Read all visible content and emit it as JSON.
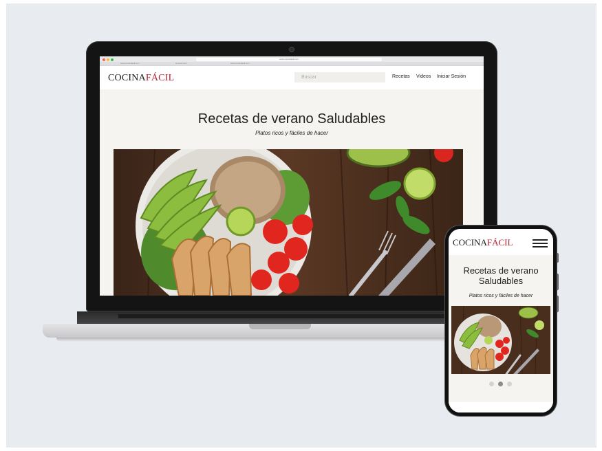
{
  "browser": {
    "url": "www.cocinafacil.com",
    "tabs": [
      "www.cocinafacil.com",
      "Cocina Fácil",
      "www.cocinafacil.com"
    ]
  },
  "site": {
    "logo_main": "COCINA",
    "logo_accent": "FÁCIL",
    "accent_color": "#b01e2f",
    "search_placeholder": "Buscar",
    "nav": {
      "recipes": "Recetas",
      "videos": "Videos",
      "login": "Iniciar Sesión"
    },
    "hero": {
      "title": "Recetas de verano Saludables",
      "subtitle": "Platos ricos y fáciles de hacer",
      "image_alt": "salad-bowl-photo"
    }
  },
  "mobile": {
    "logo_main": "COCINA",
    "logo_accent": "FÁCIL",
    "title": "Recetas de verano Saludables",
    "subtitle": "Platos ricos y fáciles de hacer",
    "carousel": {
      "count": 3,
      "active": 2
    }
  }
}
